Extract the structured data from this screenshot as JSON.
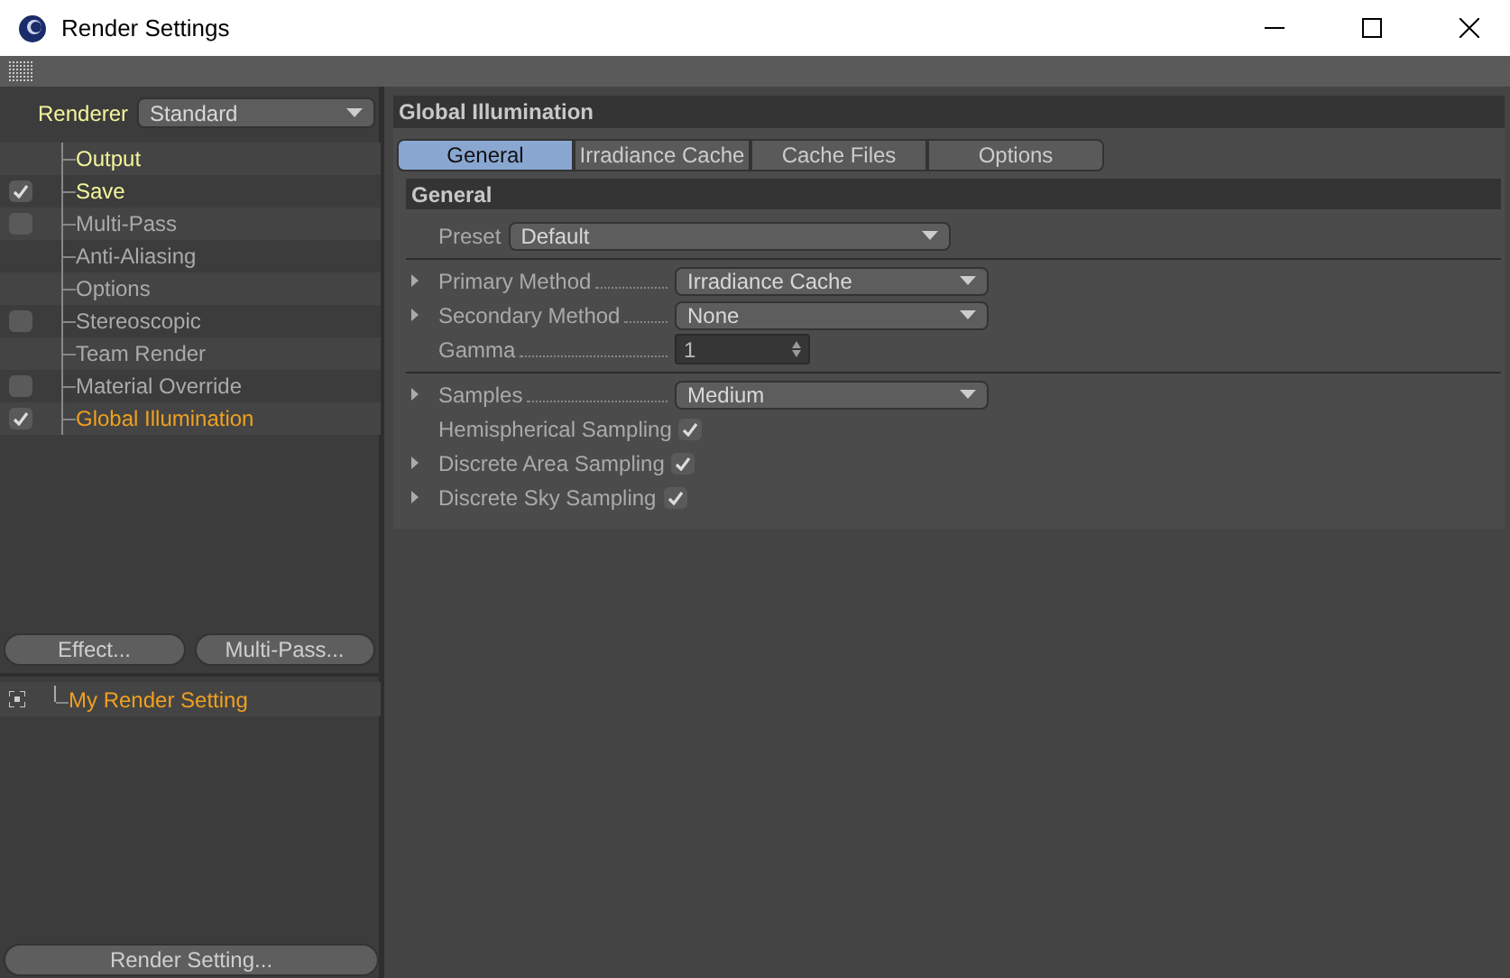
{
  "window": {
    "title": "Render Settings"
  },
  "renderer": {
    "label": "Renderer",
    "value": "Standard"
  },
  "nav": [
    {
      "label": "Output",
      "kind": "plain",
      "active": true,
      "selected": false
    },
    {
      "label": "Save",
      "kind": "checkbox",
      "checked": true,
      "active": true,
      "selected": false
    },
    {
      "label": "Multi-Pass",
      "kind": "checkbox",
      "checked": false,
      "active": false,
      "selected": false
    },
    {
      "label": "Anti-Aliasing",
      "kind": "plain",
      "active": false,
      "selected": false
    },
    {
      "label": "Options",
      "kind": "plain",
      "active": false,
      "selected": false
    },
    {
      "label": "Stereoscopic",
      "kind": "checkbox",
      "checked": false,
      "active": false,
      "selected": false
    },
    {
      "label": "Team Render",
      "kind": "plain",
      "active": false,
      "selected": false
    },
    {
      "label": "Material Override",
      "kind": "checkbox",
      "checked": false,
      "active": false,
      "selected": false
    },
    {
      "label": "Global Illumination",
      "kind": "checkbox",
      "checked": true,
      "active": false,
      "selected": true
    }
  ],
  "left_buttons": [
    "Effect...",
    "Multi-Pass..."
  ],
  "settings": [
    {
      "label": "My Render Setting"
    }
  ],
  "bottom_button": "Render Setting...",
  "panel": {
    "title": "Global Illumination",
    "tabs": [
      {
        "label": "General",
        "selected": true
      },
      {
        "label": "Irradiance Cache",
        "selected": false
      },
      {
        "label": "Cache Files",
        "selected": false
      },
      {
        "label": "Options",
        "selected": false
      }
    ],
    "section": "General",
    "groups": [
      [
        {
          "kind": "dropdown",
          "label": "Preset",
          "value": "Default",
          "expandable": false,
          "leader": false
        }
      ],
      [
        {
          "kind": "dropdown",
          "label": "Primary Method",
          "value": "Irradiance Cache",
          "expandable": true,
          "leader": true
        },
        {
          "kind": "dropdown",
          "label": "Secondary Method",
          "value": "None",
          "expandable": true,
          "leader": true
        },
        {
          "kind": "number",
          "label": "Gamma",
          "value": "1",
          "expandable": false,
          "leader": true
        }
      ],
      [
        {
          "kind": "dropdown",
          "label": "Samples",
          "value": "Medium",
          "expandable": true,
          "leader": true
        },
        {
          "kind": "checkbox",
          "label": "Hemispherical Sampling",
          "checked": true,
          "expandable": false,
          "leader": false
        },
        {
          "kind": "checkbox",
          "label": "Discrete Area Sampling",
          "checked": true,
          "expandable": true,
          "leader": false
        },
        {
          "kind": "checkbox",
          "label": "Discrete Sky Sampling",
          "checked": true,
          "expandable": true,
          "leader": false
        }
      ]
    ]
  }
}
